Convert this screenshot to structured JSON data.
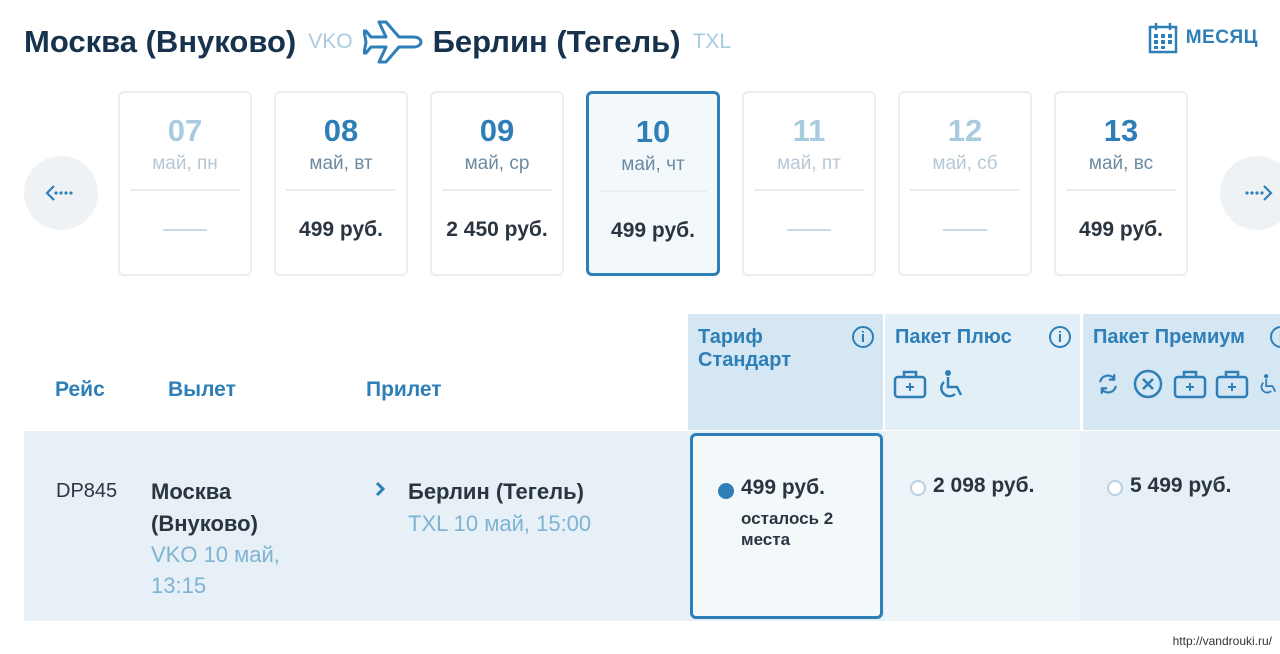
{
  "route": {
    "origin_city": "Москва (Внуково)",
    "origin_code": "VKO",
    "destination_city": "Берлин (Тегель)",
    "destination_code": "TXL",
    "plane_icon": "plane-icon"
  },
  "month_button": {
    "label": "МЕСЯЦ",
    "icon": "calendar-icon"
  },
  "nav": {
    "prev_icon": "arrow-left-icon",
    "next_icon": "arrow-right-icon"
  },
  "days": [
    {
      "num": "07",
      "weekday": "май, пн",
      "price": "",
      "state": "muted"
    },
    {
      "num": "08",
      "weekday": "май, вт",
      "price": "499 руб.",
      "state": "normal"
    },
    {
      "num": "09",
      "weekday": "май, ср",
      "price": "2 450 руб.",
      "state": "normal"
    },
    {
      "num": "10",
      "weekday": "май, чт",
      "price": "499 руб.",
      "state": "selected"
    },
    {
      "num": "11",
      "weekday": "май, пт",
      "price": "",
      "state": "muted"
    },
    {
      "num": "12",
      "weekday": "май, сб",
      "price": "",
      "state": "muted"
    },
    {
      "num": "13",
      "weekday": "май, вс",
      "price": "499 руб.",
      "state": "normal"
    }
  ],
  "table": {
    "col_flight": "Рейс",
    "col_departure": "Вылет",
    "col_arrival": "Прилет",
    "tariffs": [
      {
        "name": "Тариф Стандарт",
        "name_line1": "Тариф",
        "name_line2": "Стандарт",
        "icons": []
      },
      {
        "name": "Пакет Плюс",
        "icons": [
          "baggage-icon",
          "wheelchair-icon"
        ]
      },
      {
        "name": "Пакет Премиум",
        "icons": [
          "exchange-icon",
          "cancel-icon",
          "baggage-icon",
          "baggage-icon",
          "wheelchair-icon"
        ]
      }
    ]
  },
  "flight": {
    "number": "DP845",
    "dep_city": "Москва (Внуково)",
    "dep_meta": "VKO 10 май, 13:15",
    "arr_city": "Берлин (Тегель)",
    "arr_meta": "TXL 10 май, 15:00",
    "fares": [
      {
        "price": "499 руб.",
        "note": "осталось 2 места",
        "selected": true
      },
      {
        "price": "2 098 руб.",
        "selected": false
      },
      {
        "price": "5 499 руб.",
        "selected": false
      }
    ]
  },
  "footer": {
    "url": "http://vandrouki.ru/"
  },
  "colors": {
    "accent": "#2e7fb8",
    "muted": "#a9cbe0",
    "row_bg": "#e7f0f6",
    "header_bg": "#d5e7f2"
  }
}
